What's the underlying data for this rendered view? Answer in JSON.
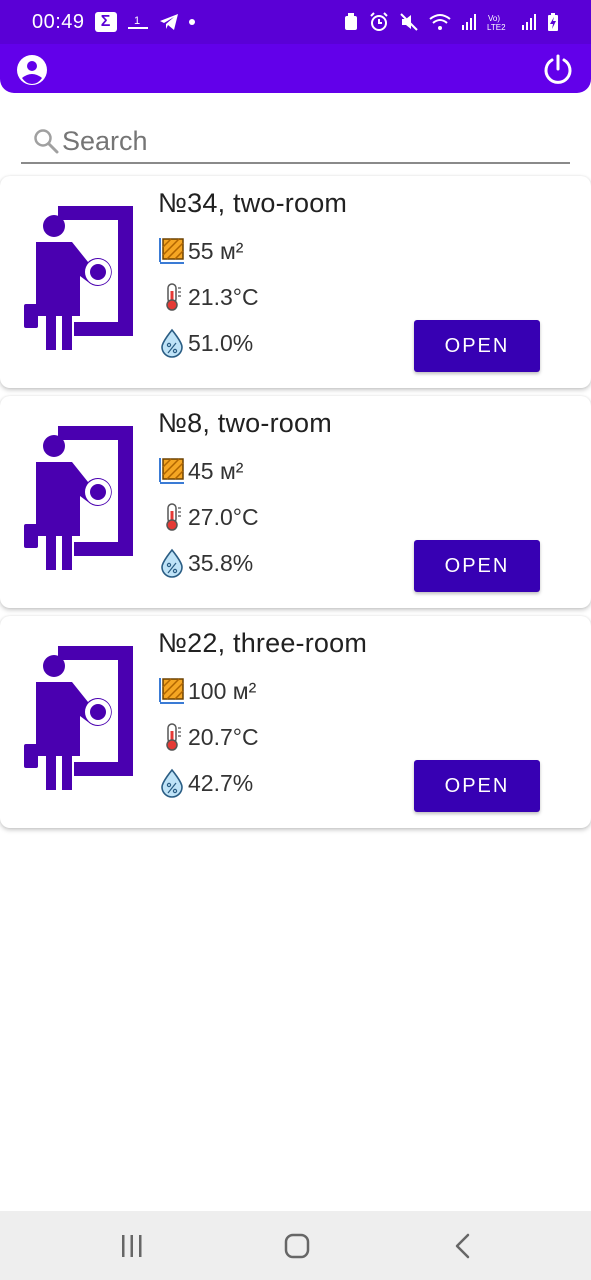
{
  "status_bar": {
    "time": "00:49",
    "left_icons": [
      "sigma-icon",
      "1more-icon",
      "telegram-icon",
      "dot-icon"
    ],
    "right_icons": [
      "nfc-icon",
      "alarm-icon",
      "mute-icon",
      "wifi-icon",
      "signal-icon",
      "volte-icon",
      "signal-icon",
      "battery-charging-icon"
    ]
  },
  "app_bar": {
    "background": "#6200ea",
    "left_icon": "account-icon",
    "right_icon": "power-icon"
  },
  "search": {
    "placeholder": "Search",
    "value": ""
  },
  "apartments": [
    {
      "title": "№34, two-room",
      "area": "55 м²",
      "temperature": "21.3°C",
      "humidity": "51.0%",
      "button": "OPEN"
    },
    {
      "title": "№8, two-room",
      "area": "45 м²",
      "temperature": "27.0°C",
      "humidity": "35.8%",
      "button": "OPEN"
    },
    {
      "title": "№22, three-room",
      "area": "100 м²",
      "temperature": "20.7°C",
      "humidity": "42.7%",
      "button": "OPEN"
    }
  ],
  "colors": {
    "primary": "#6200ea",
    "status_bar": "#5a00d6",
    "button": "#3700b3",
    "icon_purple": "#4a00b0"
  },
  "nav_bar": {
    "items": [
      "recents-icon",
      "home-icon",
      "back-icon"
    ]
  }
}
